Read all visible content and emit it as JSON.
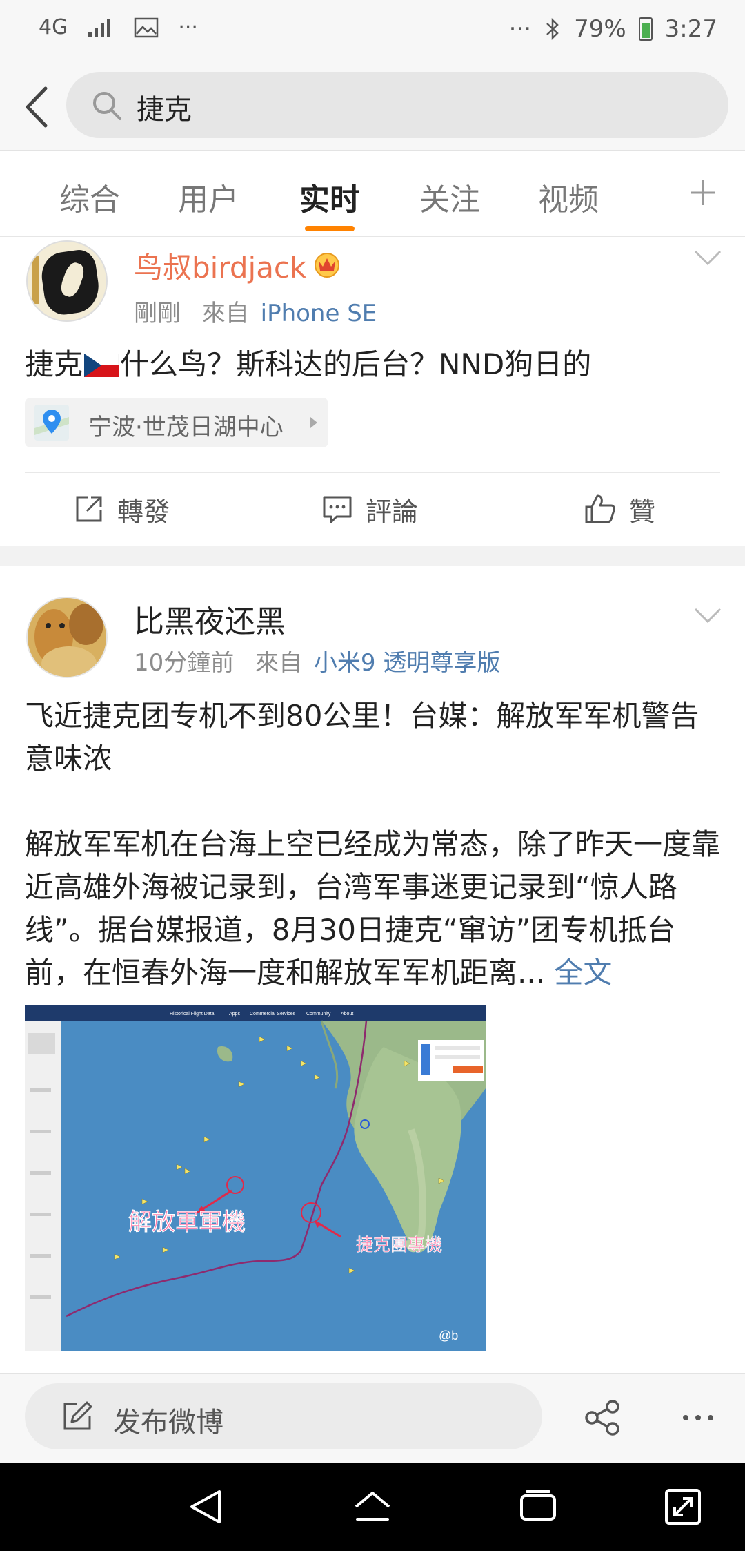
{
  "status_bar": {
    "network": "4G",
    "battery": "79%",
    "time": "3:27",
    "colors": {
      "battery_fill": "#4caf50"
    }
  },
  "search": {
    "query": "捷克"
  },
  "tabs": [
    {
      "label": "综合",
      "active": false
    },
    {
      "label": "用户",
      "active": false
    },
    {
      "label": "实时",
      "active": true
    },
    {
      "label": "关注",
      "active": false
    },
    {
      "label": "视频",
      "active": false
    }
  ],
  "accent_color": "#ff8200",
  "post1": {
    "username": "鸟叔birdjack",
    "time": "剛剛",
    "from_prefix": "來自",
    "source": "iPhone SE",
    "text_before_flag": "捷克",
    "text_after_flag": "什么鸟？斯科达的后台？NND狗日的",
    "location": "宁波·世茂日湖中心"
  },
  "actions": {
    "repost": "轉發",
    "comment": "評論",
    "like": "贊"
  },
  "post2": {
    "username": "比黑夜还黑",
    "time": "10分鐘前",
    "from_prefix": "來自",
    "source": "小米9 透明尊享版",
    "headline": "飞近捷克团专机不到80公里！台媒：解放军军机警告意味浓",
    "body": "解放军军机在台海上空已经成为常态，除了昨天一度靠近高雄外海被记录到，台湾军事迷更记录到“惊人路线”。据台媒报道，8月30日捷克“窜访”团专机抵台前，在恒春外海一度和解放军军机距离...",
    "full_text_link": "全文",
    "image": {
      "label_pla": "解放軍軍機",
      "label_czech": "捷克團專機",
      "nav_items": [
        "Historical Flight Data",
        "Apps",
        "Commercial Services",
        "Community",
        "About"
      ]
    }
  },
  "bottom_bar": {
    "compose_label": "发布微博"
  }
}
